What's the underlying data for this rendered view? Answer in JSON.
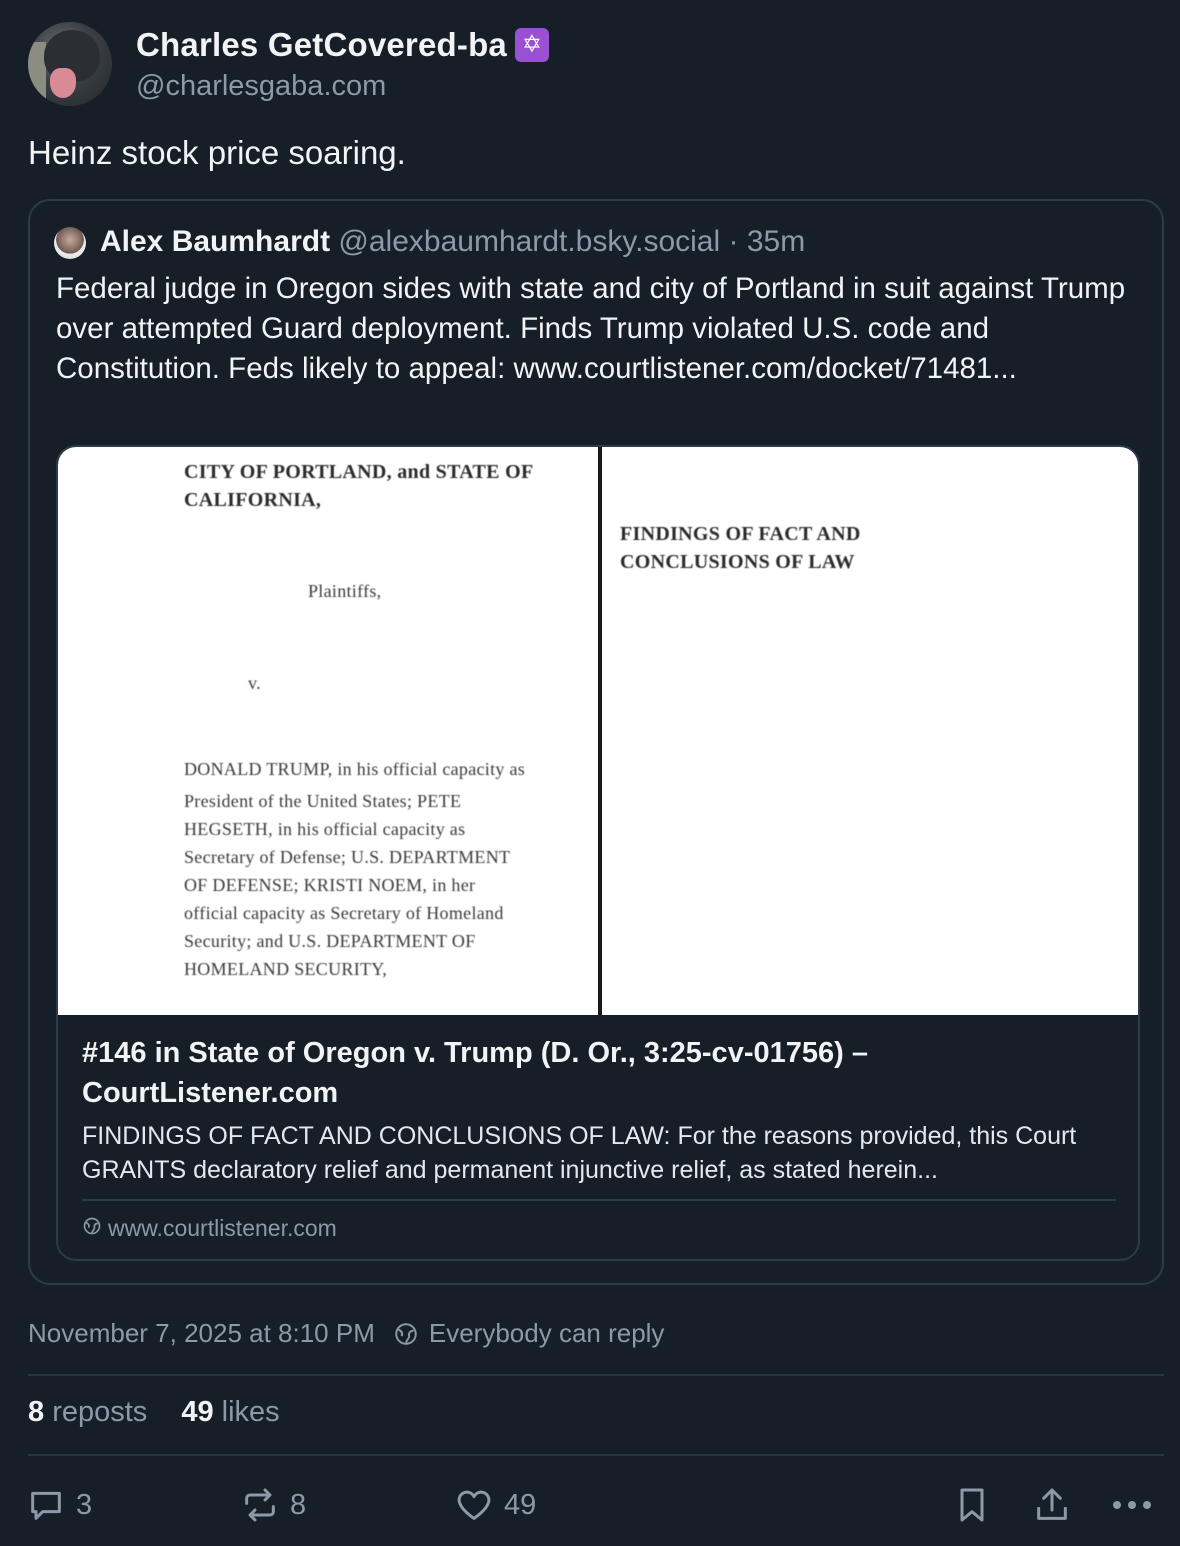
{
  "author": {
    "name": "Charles GetCovered-ba",
    "badge": "✡",
    "handle": "@charlesgaba.com"
  },
  "post": {
    "text": "Heinz stock price soaring."
  },
  "quote": {
    "name": "Alex Baumhardt",
    "handle": "@alexbaumhardt.bsky.social",
    "dot": "·",
    "time": "35m",
    "body": "Federal judge in Oregon sides with state and city of Portland in suit against Trump over attempted Guard deployment. Finds Trump violated U.S. code and Constitution. Feds likely to appeal: www.courtlistener.com/docket/71481...",
    "link_card": {
      "document": {
        "left_lines": [
          "CITY OF PORTLAND, and STATE OF",
          "CALIFORNIA,",
          "Plaintiffs,",
          "v.",
          "DONALD TRUMP, in his official capacity as",
          "President of the United States; PETE",
          "HEGSETH, in his official capacity as",
          "Secretary of Defense; U.S. DEPARTMENT",
          "OF DEFENSE; KRISTI NOEM, in her",
          "official capacity as Secretary of Homeland",
          "Security; and U.S. DEPARTMENT OF",
          "HOMELAND SECURITY,"
        ],
        "right_lines": [
          "FINDINGS OF FACT AND",
          "CONCLUSIONS OF LAW"
        ]
      },
      "title": "#146 in State of Oregon v. Trump (D. Or., 3:25-cv-01756) – CourtListener.com",
      "description": "FINDINGS OF FACT AND CONCLUSIONS OF LAW: For the reasons provided, this Court GRANTS declaratory relief and permanent injunctive relief, as stated herein...",
      "domain": "www.courtlistener.com"
    }
  },
  "meta": {
    "timestamp": "November 7, 2025 at 8:10 PM",
    "reply_setting": "Everybody can reply"
  },
  "stats": {
    "reposts_count": "8",
    "reposts_label": "reposts",
    "likes_count": "49",
    "likes_label": "likes"
  },
  "actions": {
    "reply_count": "3",
    "repost_count": "8",
    "like_count": "49",
    "icons": [
      "reply-icon",
      "repost-icon",
      "like-icon",
      "bookmark-icon",
      "share-icon",
      "more-icon"
    ]
  },
  "colors": {
    "background": "#161e27",
    "text_primary": "#f1f3f5",
    "text_secondary": "#8d99a8",
    "border": "#2e3a47",
    "badge": "#9b4fd1"
  }
}
